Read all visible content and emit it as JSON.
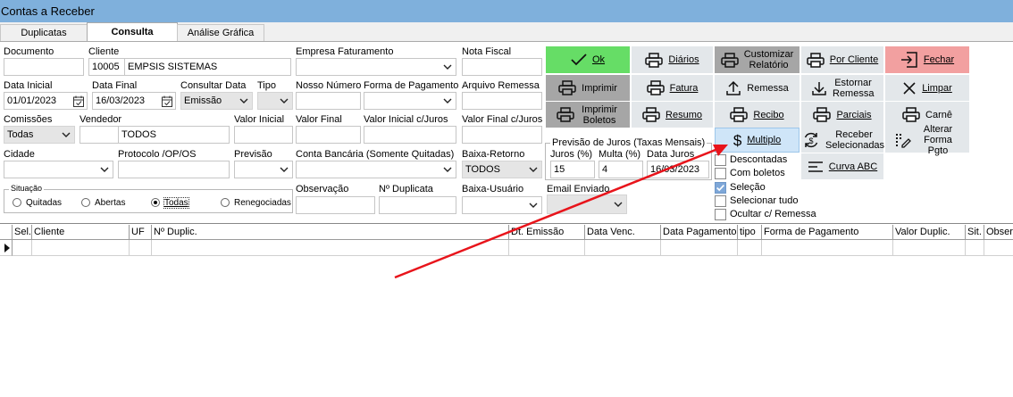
{
  "window": {
    "title": "Contas a Receber"
  },
  "tabs": [
    {
      "label": "Duplicatas"
    },
    {
      "label": "Consulta"
    },
    {
      "label": "Análise Gráfica"
    }
  ],
  "fields": {
    "documento": {
      "label": "Documento",
      "value": ""
    },
    "cliente": {
      "label": "Cliente",
      "code": "10005",
      "name": "EMPSIS SISTEMAS"
    },
    "empresa_faturamento": {
      "label": "Empresa Faturamento",
      "value": ""
    },
    "nota_fiscal": {
      "label": "Nota Fiscal",
      "value": ""
    },
    "data_inicial": {
      "label": "Data Inicial",
      "value": "01/01/2023"
    },
    "data_final": {
      "label": "Data Final",
      "value": "16/03/2023"
    },
    "consultar_data": {
      "label": "Consultar Data",
      "value": "Emissão"
    },
    "tipo": {
      "label": "Tipo",
      "value": ""
    },
    "nosso_numero": {
      "label": "Nosso Número",
      "value": ""
    },
    "forma_pagamento": {
      "label": "Forma de Pagamento",
      "value": ""
    },
    "arquivo_remessa": {
      "label": "Arquivo Remessa",
      "value": ""
    },
    "comissoes": {
      "label": "Comissões",
      "value": "Todas"
    },
    "vendedor": {
      "label": "Vendedor",
      "code": "",
      "name": "TODOS"
    },
    "valor_inicial": {
      "label": "Valor Inicial",
      "value": ""
    },
    "valor_final": {
      "label": "Valor Final",
      "value": ""
    },
    "valor_inicial_juros": {
      "label": "Valor Inicial c/Juros",
      "value": ""
    },
    "valor_final_juros": {
      "label": "Valor Final c/Juros",
      "value": ""
    },
    "cidade": {
      "label": "Cidade",
      "value": ""
    },
    "protocolo": {
      "label": "Protocolo /OP/OS",
      "value": ""
    },
    "previsao": {
      "label": "Previsão",
      "value": ""
    },
    "conta_bancaria": {
      "label": "Conta Bancária (Somente Quitadas)",
      "value": ""
    },
    "baixa_retorno": {
      "label": "Baixa-Retorno",
      "value": "TODOS"
    },
    "observacao": {
      "label": "Observação",
      "value": ""
    },
    "num_duplicata": {
      "label": "Nº Duplicata",
      "value": ""
    },
    "baixa_usuario": {
      "label": "Baixa-Usuário",
      "value": ""
    },
    "email_enviado": {
      "label": "Email Enviado",
      "value": ""
    }
  },
  "situacao": {
    "label": "Situação",
    "options": [
      "Quitadas",
      "Abertas",
      "Todas",
      "Renegociadas"
    ],
    "selected": "Todas"
  },
  "previsao_juros": {
    "label": "Previsão de Juros (Taxas Mensais)",
    "juros_label": "Juros (%)",
    "juros_value": "15",
    "multa_label": "Multa (%)",
    "multa_value": "4",
    "data_label": "Data Juros",
    "data_value": "16/03/2023"
  },
  "checkboxes": [
    {
      "label": "Descontadas",
      "checked": false
    },
    {
      "label": "Com boletos",
      "checked": false
    },
    {
      "label": "Seleção",
      "checked": true
    },
    {
      "label": "Selecionar tudo",
      "checked": false
    },
    {
      "label": "Ocultar c/ Remessa",
      "checked": false
    }
  ],
  "buttons": {
    "ok": "Ok",
    "diarios": "Diários",
    "customizar": "Customizar Relatório",
    "por_cliente": "Por Cliente",
    "fechar": "Fechar",
    "imprimir": "Imprimir",
    "fatura": "Fatura",
    "remessa": "Remessa",
    "estornar_remessa": "Estornar Remessa",
    "limpar": "Limpar",
    "imprimir_boletos": "Imprimir Boletos",
    "resumo": "Resumo",
    "recibo": "Recibo",
    "parciais": "Parciais",
    "carne": "Carnê",
    "multiplo": "Multiplo",
    "receber_selecionadas": "Receber Selecionadas",
    "alterar_forma_pgto": "Alterar Forma Pgto",
    "curva_abc": "Curva ABC"
  },
  "grid": {
    "columns": [
      "Sel.",
      "Cliente",
      "UF",
      "Nº Duplic.",
      "Dt. Emissão",
      "Data Venc.",
      "Data Pagamento",
      "tipo",
      "Forma de Pagamento",
      "Valor Duplic.",
      "Sit.",
      "Obser"
    ]
  },
  "colors": {
    "titlebar": "#7fb0dc",
    "ok_button": "#66dd66",
    "fechar_button": "#f2a0a0",
    "dark_button": "#a6a6a6",
    "light_button": "#e3e7ea",
    "multiplo_highlight": "#cfe5f8",
    "arrow": "#e8141b"
  }
}
